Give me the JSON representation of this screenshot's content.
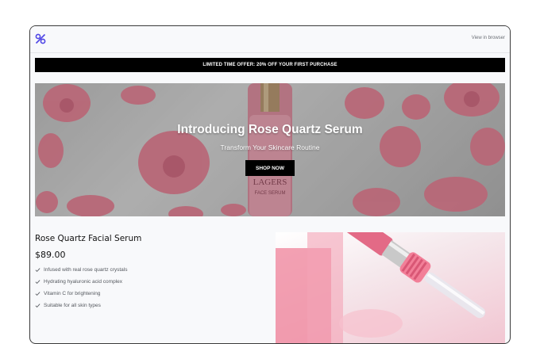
{
  "header": {
    "logo_icon": "brand-logo-icon",
    "view_in_browser": "View in browser"
  },
  "offer_banner": {
    "text": "LIMITED TIME OFFER: 20% OFF YOUR FIRST PURCHASE"
  },
  "hero": {
    "title": "Introducing Rose Quartz Serum",
    "subtitle": "Transform Your Skincare Routine",
    "cta_label": "SHOP NOW",
    "bottle_label_brand": "LAGERS",
    "bottle_label_type": "FACE SERUM"
  },
  "product": {
    "name": "Rose Quartz Facial Serum",
    "price": "$89.00",
    "features": [
      "Infused with real rose quartz crystals",
      "Hydrating hyaluronic acid complex",
      "Vitamin C for brightening",
      "Suitable for all skin types"
    ]
  },
  "colors": {
    "accent": "#000000",
    "logo": "#4f46e5",
    "petal": "#e8798f",
    "serum": "#f08aa0"
  }
}
